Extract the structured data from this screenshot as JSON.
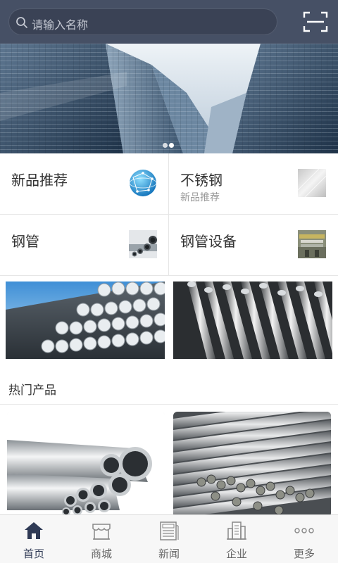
{
  "search": {
    "placeholder": "请输入名称",
    "icon": "search-icon"
  },
  "header": {
    "scan_icon": "scan-icon"
  },
  "banner": {
    "slides": 2,
    "active_slide": 1
  },
  "categories": [
    {
      "title": "新品推荐",
      "subtitle": "",
      "icon": "globe-icon"
    },
    {
      "title": "不锈钢",
      "subtitle": "新品推荐",
      "icon": "steel-sheet-icon"
    },
    {
      "title": "钢管",
      "subtitle": "",
      "icon": "steel-pipe-icon"
    },
    {
      "title": "钢管设备",
      "subtitle": "",
      "icon": "pipe-equipment-icon"
    }
  ],
  "hot": {
    "title": "热门产品"
  },
  "tabs": [
    {
      "label": "首页",
      "icon": "home-icon",
      "active": true
    },
    {
      "label": "商城",
      "icon": "store-icon",
      "active": false
    },
    {
      "label": "新闻",
      "icon": "news-icon",
      "active": false
    },
    {
      "label": "企业",
      "icon": "building-icon",
      "active": false
    },
    {
      "label": "更多",
      "icon": "more-icon",
      "active": false
    }
  ],
  "colors": {
    "header": "#465065",
    "active_tab": "#2f3a55",
    "inactive_tab": "#666666"
  }
}
